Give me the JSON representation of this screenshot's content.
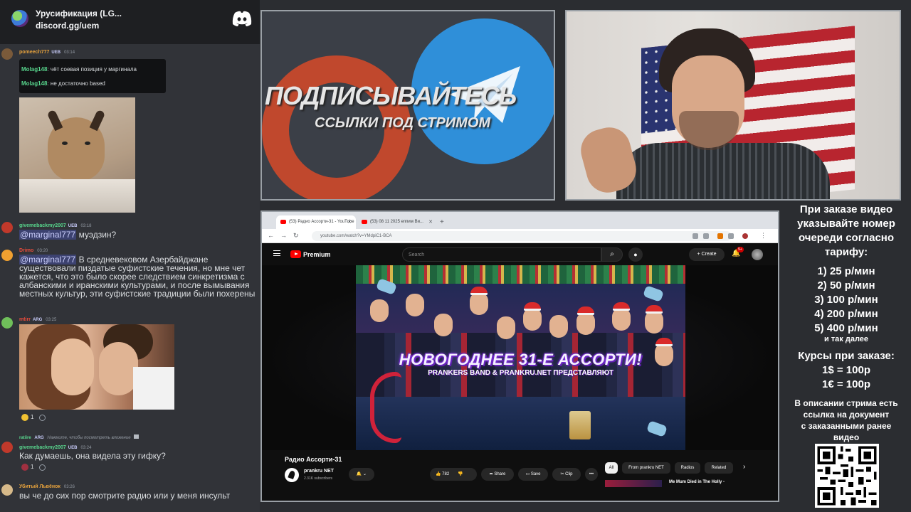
{
  "discord": {
    "server_title": "Урусификация (LG...",
    "server_invite": "discord.gg/uem",
    "messages": [
      {
        "user": "pomeech777",
        "tag": "UEB",
        "time": "03:14",
        "user_color": "#e8a33d"
      },
      {
        "quotes": [
          {
            "user": "Molag148",
            "text": "чёт соевая позиция у маргинала"
          },
          {
            "user": "Molag148",
            "text": "не достаточно based"
          }
        ]
      },
      {
        "user": "givemebackmy2007",
        "tag": "UEB",
        "time": "03:18",
        "mention": "@marginal777",
        "text": "муэдзин?",
        "user_color": "#58d68d"
      },
      {
        "user": "Drimo",
        "time": "03:20",
        "mention": "@marginal777",
        "text": "В средневековом Азербайджане существовали пиздатые суфистские течения, но мне чет кажется, что это было скорее следствием синкретизма с албанскими и иранскими культурами, и после вымывания местных культур, эти суфистские традиции были похерены",
        "user_color": "#e74c3c"
      },
      {
        "user": "mtirr",
        "tag": "ARG",
        "time": "03:25",
        "user_color": "#e74c3c",
        "reaction_count": "1"
      },
      {
        "reply_user": "ratiire",
        "reply_tag": "ARG",
        "reply_text": "Нажмите, чтобы посмотреть вложение",
        "user": "givemebackmy2007",
        "tag": "UEB",
        "time": "03:24",
        "text": "Как думаешь, она видела эту гифку?",
        "user_color": "#58d68d",
        "reaction_count": "1"
      },
      {
        "user": "Убитый Львёнок",
        "time": "03:26",
        "text": "вы че до сих пор смотрите радио или у меня инсульт",
        "user_color": "#e8a33d"
      }
    ]
  },
  "promo": {
    "main": "ПОДПИСЫВАЙТЕСЬ",
    "sub": "ССЫЛКИ ПОД СТРИМОМ",
    "colors": {
      "boosty": "#c0482d",
      "telegram": "#2f8fd9"
    }
  },
  "browser": {
    "tabs": [
      {
        "label": "(53) Радио Ассорти-31 - YouTube",
        "active": true
      },
      {
        "label": "(53) 08 11 2025 еппим Ви...",
        "active": false
      }
    ],
    "url": "youtube.com/watch?v=YMdpiC1-BCA",
    "youtube": {
      "brand": "Premium",
      "search_placeholder": "Search",
      "create_label": "Create",
      "notif_badge": "9+",
      "thumbnail_title": "НОВОГОДНЕЕ 31-Е АССОРТИ!",
      "thumbnail_sub": "PRANKERS BAND & PRANKRU.NET ПРЕДСТАВЛЯЮТ",
      "video_title": "Радио Ассорти-31",
      "channel_name": "prankru NET",
      "channel_subs": "2.31K subscribers",
      "likes": "782",
      "share_label": "Share",
      "save_label": "Save",
      "clip_label": "Clip",
      "chips": [
        "All",
        "From prankru NET",
        "Radios",
        "Related"
      ],
      "rec_title": "Me Mum Died in The Holly -"
    }
  },
  "pricing": {
    "intro": [
      "При заказе видео",
      "указывайте номер",
      "очереди согласно",
      "тарифу:"
    ],
    "tiers": [
      "1) 25 р/мин",
      "2) 50 р/мин",
      "3) 100 р/мин",
      "4) 200 р/мин",
      "5) 400 р/мин"
    ],
    "etc": "и так далее",
    "rates_title": "Курсы при заказе:",
    "rates": [
      "1$ = 100р",
      "1€ = 100р"
    ],
    "note": [
      "В описании стрима есть",
      "ссылка на документ",
      "с заказанными ранее",
      "видео"
    ]
  }
}
